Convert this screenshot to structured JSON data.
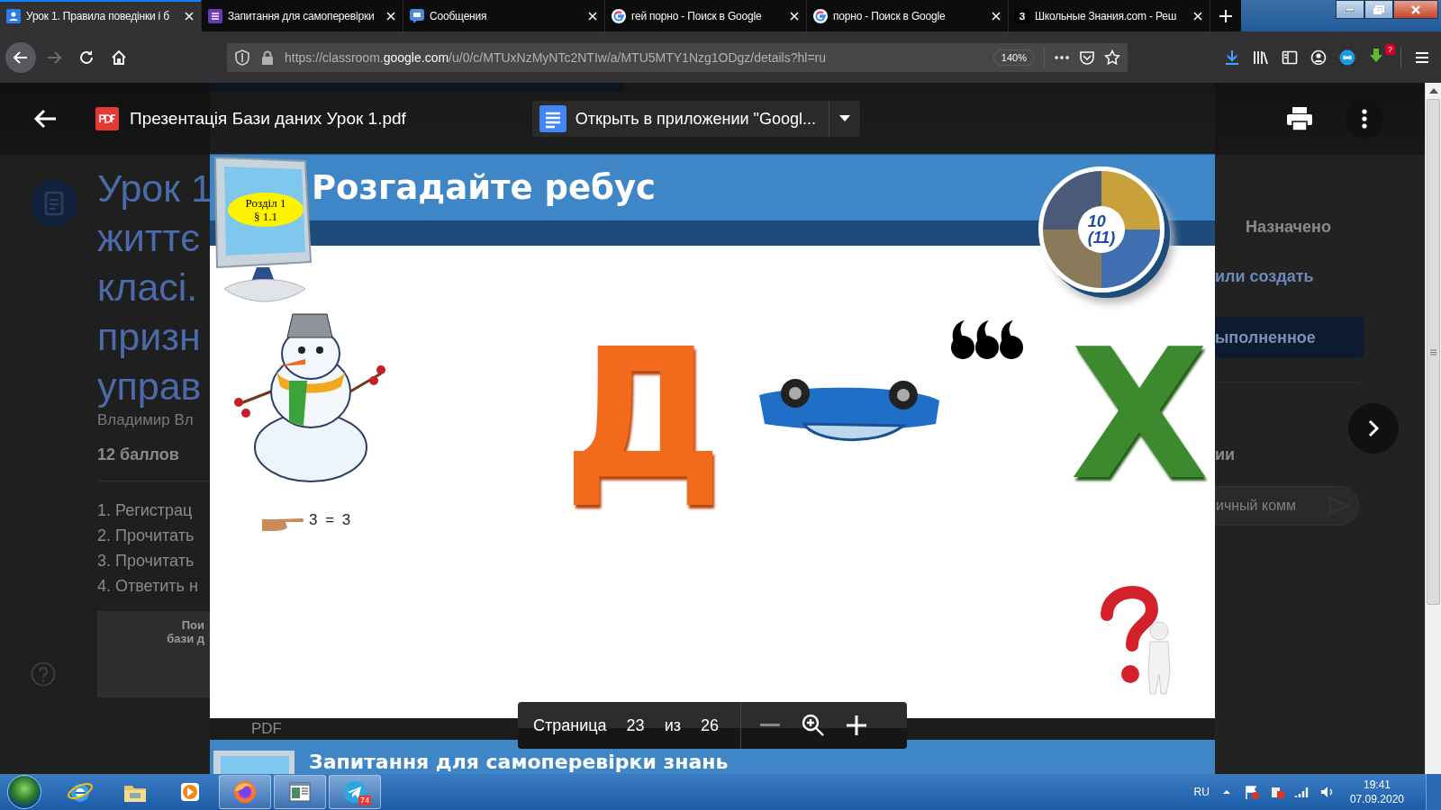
{
  "browser": {
    "tabs": [
      {
        "title": "Урок 1. Правила поведінки і б",
        "kind": "classroom",
        "selected": true
      },
      {
        "title": "Запитання для самоперевірки",
        "kind": "forms",
        "selected": false
      },
      {
        "title": "Сообщения",
        "kind": "chat",
        "selected": false
      },
      {
        "title": "гей порно - Поиск в Google",
        "kind": "google",
        "selected": false
      },
      {
        "title": "порно - Поиск в Google",
        "kind": "google",
        "selected": false
      },
      {
        "title": "Школьные Знания.com - Реш",
        "kind": "letter",
        "icon_text": "З",
        "selected": false
      }
    ],
    "address": {
      "scheme": "https://classroom.",
      "domain": "google.com",
      "path": "/u/0/c/MTUxNzMyNTc2NTIw/a/MTU5MTY1Nzg1ODgz/details?hl=ru"
    },
    "zoom": "140%",
    "addon_badge": "?"
  },
  "classroom": {
    "title_lines": [
      "Урок 1",
      "життє",
      "класі.",
      "призн",
      "управ"
    ],
    "author": "Владимир Вл",
    "points": "12 баллов",
    "steps": [
      "1. Регистрац",
      "2. Прочитать",
      "3. Прочитать",
      "4. Ответить н"
    ],
    "attachment": {
      "title_lines": [
        "Пои",
        "бази д"
      ],
      "type": "PDF"
    },
    "status": "Назначено",
    "add_link": "или создать",
    "done_button": "ыполненное",
    "comments_heading": "ии",
    "comment_placeholder": "ичный комм"
  },
  "viewer": {
    "file_title": "Презентація Бази даних Урок 1.pdf",
    "open_button": "Открыть в приложении \"Googl...",
    "page_label": "Страница",
    "page": "23",
    "of_label": "из",
    "page_count": "26"
  },
  "slide": {
    "section_badge": [
      "Розділ 1",
      "§ 1.1"
    ],
    "title": "Розгадайте ребус",
    "emblem": [
      "10",
      "(11)"
    ],
    "rebus": {
      "hint": "3 = 3",
      "letter_1": "Д",
      "letter_2": "Х"
    }
  },
  "next_slide": {
    "title": "Запитання для самоперевірки знань"
  },
  "taskbar": {
    "apps": [
      {
        "kind": "ie",
        "running": false
      },
      {
        "kind": "explorer",
        "running": false
      },
      {
        "kind": "media",
        "running": false
      },
      {
        "kind": "firefox",
        "running": true
      },
      {
        "kind": "window",
        "running": true
      },
      {
        "kind": "telegram",
        "running": true,
        "badge": "74"
      }
    ],
    "tray": {
      "language": "RU",
      "time": "19:41",
      "date": "07.09.2020"
    }
  }
}
